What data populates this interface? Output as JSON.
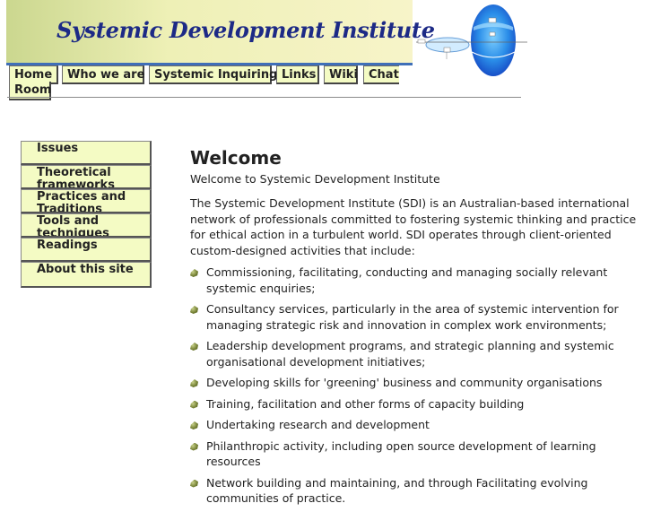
{
  "header": {
    "site_title": "Systemic Development Institute"
  },
  "top_nav": [
    {
      "label": "Home"
    },
    {
      "label": "Who we are"
    },
    {
      "label": "Systemic Inquiring"
    },
    {
      "label": "Links"
    },
    {
      "label": "Wiki"
    },
    {
      "label": "Chat"
    },
    {
      "label": "Room"
    }
  ],
  "side_nav": [
    {
      "label": "Issues"
    },
    {
      "label": "Theoretical frameworks"
    },
    {
      "label": "Practices and Traditions"
    },
    {
      "label": "Tools and techniques"
    },
    {
      "label": "Readings"
    },
    {
      "label": "About this site"
    }
  ],
  "main": {
    "heading": "Welcome",
    "subtitle": "Welcome to Systemic Development Institute",
    "intro": "The Systemic Development Institute (SDI) is an Australian-based international network of professionals committed to fostering systemic thinking and practice for ethical action in a turbulent world. SDI operates through client-oriented custom-designed activities that include:",
    "bullets": [
      "Commissioning, facilitating, conducting and managing socially relevant systemic enquiries;",
      "Consultancy services, particularly in the area of systemic intervention for managing strategic risk and innovation in complex work environments;",
      "Leadership development programs, and strategic planning and systemic organisational development initiatives;",
      "Developing skills for 'greening' business and community organisations",
      "Training, facilitation and other forms of capacity building",
      "Undertaking research and development",
      "Philanthropic activity, including open source development of learning resources",
      "Network building and maintaining, and through Facilitating evolving communities of practice."
    ]
  }
}
